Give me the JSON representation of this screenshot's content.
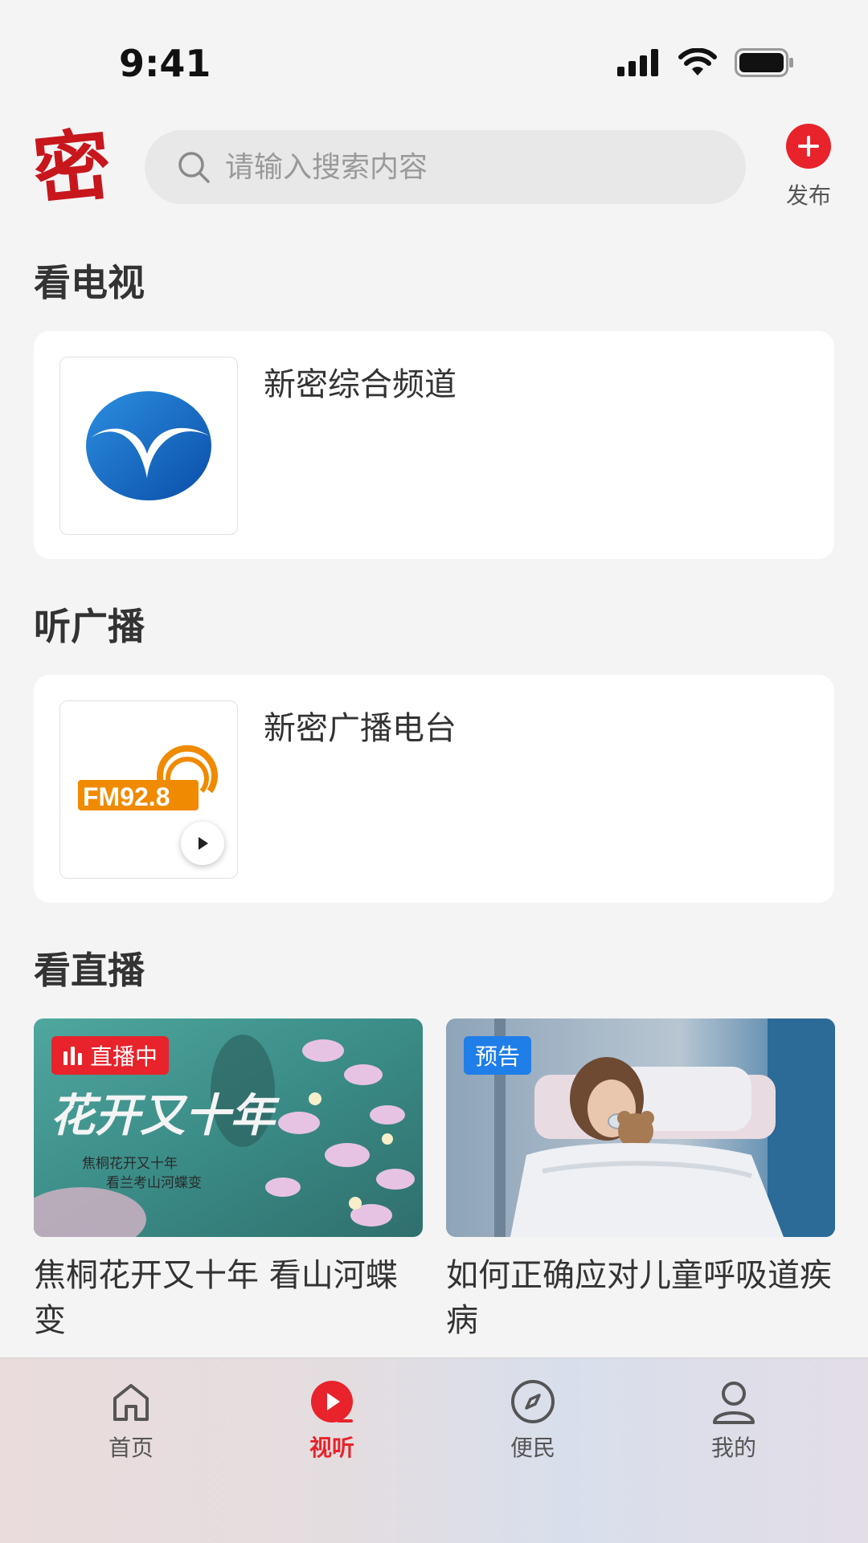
{
  "status_bar": {
    "time": "9:41"
  },
  "header": {
    "logo_text": "密",
    "search_placeholder": "请输入搜索内容",
    "publish_label": "发布"
  },
  "tv_section": {
    "title": "看电视",
    "channel_name": "新密综合频道"
  },
  "radio_section": {
    "title": "听广播",
    "station_name": "新密广播电台",
    "logo_text": "FM92.8"
  },
  "live_section": {
    "title": "看直播",
    "items": [
      {
        "badge": "直播中",
        "title": "焦桐花开又十年 看山河蝶变",
        "image_text": "花开又十年",
        "image_subtext_1": "焦桐花开又十年",
        "image_subtext_2": "看兰考山河蝶变"
      },
      {
        "badge": "预告",
        "title": "如何正确应对儿童呼吸道疾病"
      }
    ]
  },
  "tabbar": {
    "items": [
      {
        "label": "首页",
        "icon": "home-icon",
        "active": false
      },
      {
        "label": "视听",
        "icon": "play-circle-icon",
        "active": true
      },
      {
        "label": "便民",
        "icon": "compass-icon",
        "active": false
      },
      {
        "label": "我的",
        "icon": "user-icon",
        "active": false
      }
    ]
  },
  "colors": {
    "accent": "#e8232b",
    "live_badge": "#e8232b",
    "preview_badge": "#1f7ee8",
    "background": "#f4f4f4"
  }
}
